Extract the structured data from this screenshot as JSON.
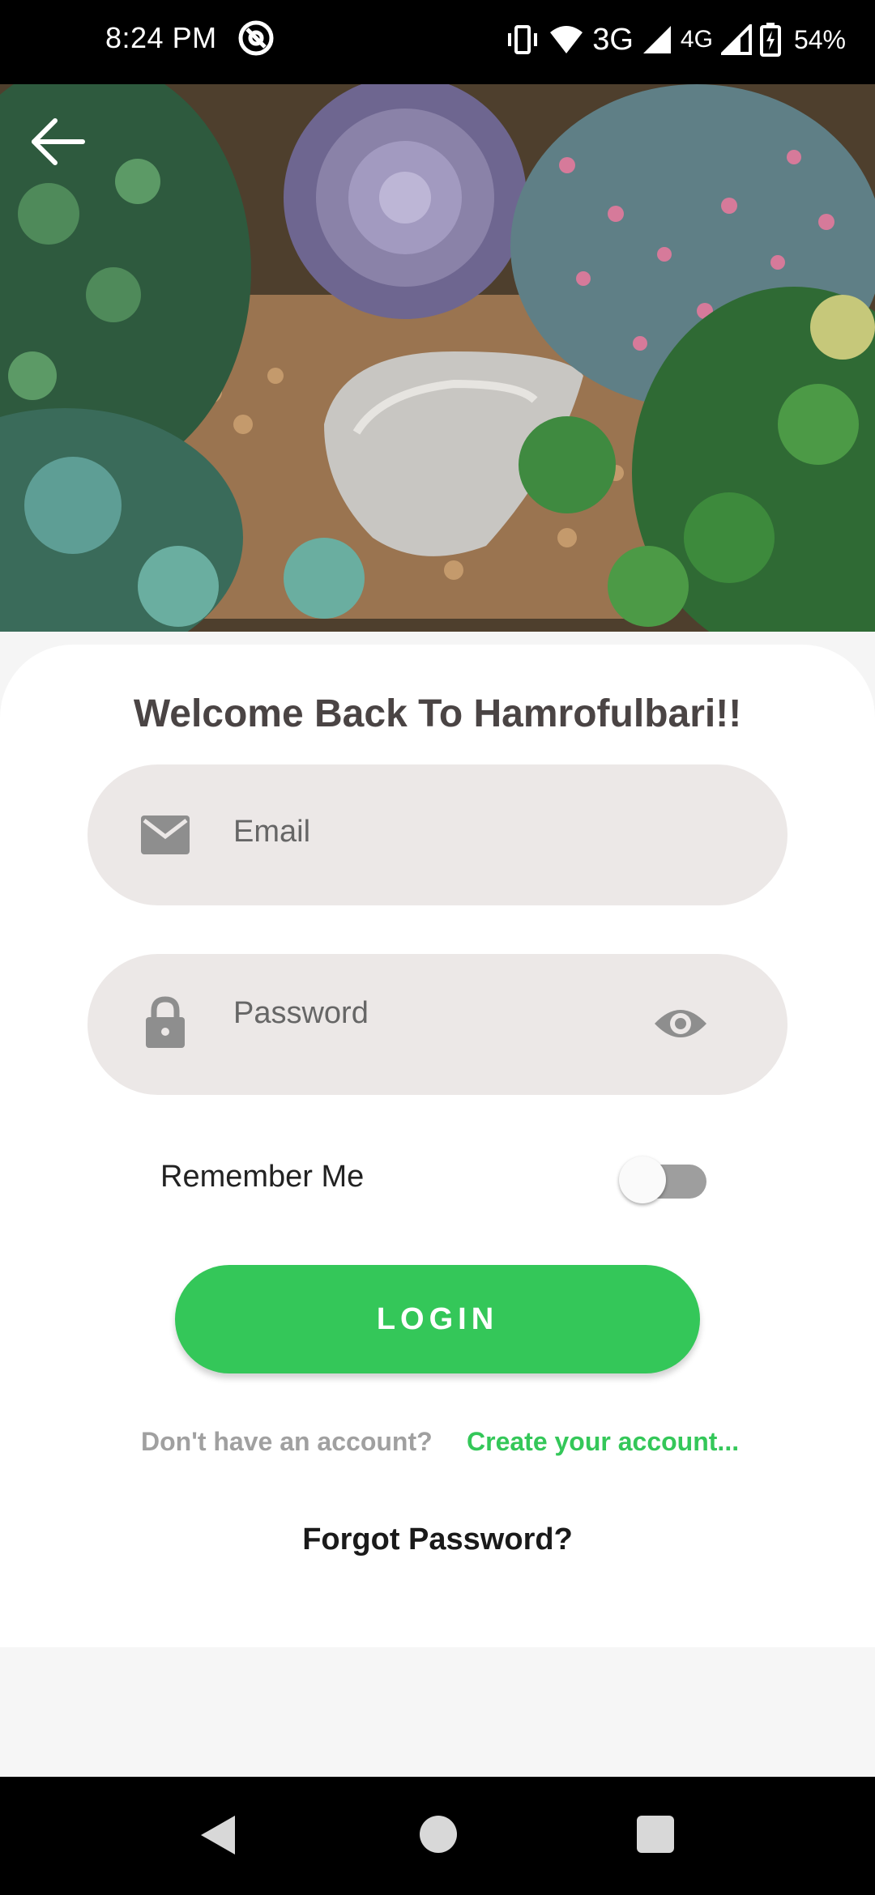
{
  "status_bar": {
    "time": "8:24 PM",
    "network_3g": "3G",
    "network_4g": "4G",
    "battery": "54%",
    "icons": [
      "at-sign-icon",
      "vibrate-icon",
      "wifi-icon",
      "signal-icon",
      "signal-icon",
      "battery-charging-icon"
    ]
  },
  "hero": {
    "image": "succulent-garden-photo",
    "back_icon": "arrow-left-icon"
  },
  "login": {
    "title": "Welcome Back To Hamrofulbari!!",
    "email_placeholder": "Email",
    "email_icon": "mail-icon",
    "password_placeholder": "Password",
    "password_icon": "lock-icon",
    "visibility_icon": "eye-icon",
    "remember_label": "Remember Me",
    "remember_on": false,
    "login_button": "LOGIN",
    "no_account_text": "Don't have an account?",
    "create_account_link": "Create your account...",
    "forgot_password": "Forgot Password?"
  },
  "colors": {
    "accent": "#34C759",
    "field_bg": "#ECE8E7",
    "title": "#4A4444",
    "muted": "#A0A0A0"
  },
  "nav_bar": {
    "icons": [
      "nav-back-icon",
      "nav-home-icon",
      "nav-recents-icon"
    ]
  }
}
